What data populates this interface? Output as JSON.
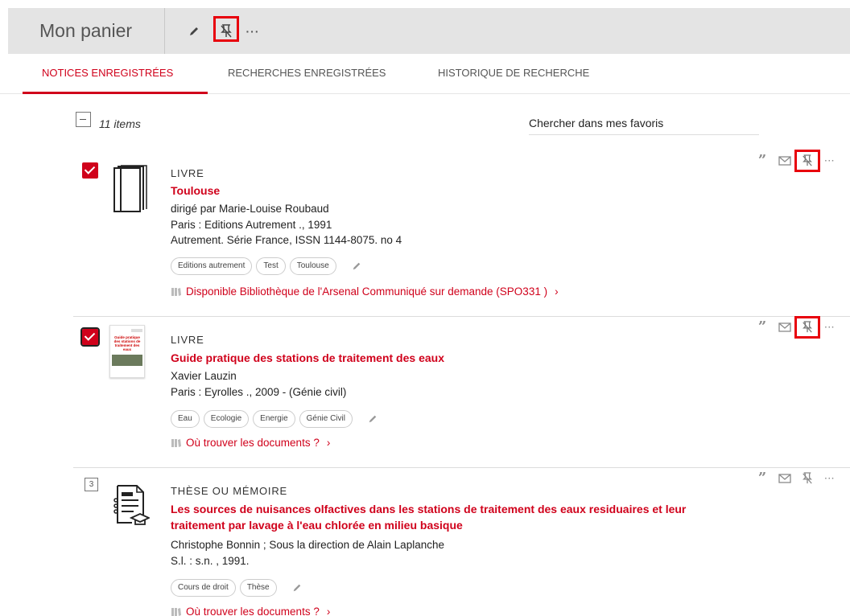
{
  "header": {
    "title": "Mon panier",
    "icons": [
      "pencil-icon",
      "unpin-icon",
      "more-icon"
    ],
    "more_label": "···"
  },
  "tabs": [
    {
      "label": "NOTICES ENREGISTRÉES",
      "active": true
    },
    {
      "label": "RECHERCHES ENREGISTRÉES",
      "active": false
    },
    {
      "label": "HISTORIQUE DE RECHERCHE",
      "active": false
    }
  ],
  "list": {
    "count": "11 items",
    "search_placeholder": "Chercher dans mes favoris"
  },
  "records": [
    {
      "checkbox": "checked",
      "type": "LIVRE",
      "title": "Toulouse",
      "lines": [
        "dirigé par Marie-Louise Roubaud",
        "Paris : Editions Autrement ., 1991",
        "Autrement. Série France, ISSN 1144-8075. no 4"
      ],
      "tags": [
        "Editions autrement",
        "Test",
        "Toulouse"
      ],
      "availability": "Disponible Bibliothèque de l'Arsenal  Communiqué sur demande (SPO331 )",
      "pin_highlighted": true
    },
    {
      "checkbox": "checked",
      "type": "LIVRE",
      "title": "Guide pratique des stations de traitement des eaux",
      "lines": [
        "Xavier Lauzin",
        "Paris : Eyrolles ., 2009 - (Génie civil)"
      ],
      "tags": [
        "Eau",
        "Ecologie",
        "Energie",
        "Génie Civil"
      ],
      "availability": "Où trouver les documents ?",
      "cover_text": "Guide pratique des stations de traitement des eaux",
      "pin_highlighted": true
    },
    {
      "checkbox": "3",
      "type": "THÈSE OU MÉMOIRE",
      "title": "Les sources de nuisances olfactives dans les stations de traitement des eaux residuaires et leur traitement par lavage à l'eau chlorée en milieu basique",
      "lines": [
        "Christophe Bonnin ; Sous la direction de Alain Laplanche",
        "S.l. : s.n. , 1991."
      ],
      "tags": [
        "Cours de droit",
        "Thèse"
      ],
      "availability": "Où trouver les documents ?",
      "pin_highlighted": false
    }
  ],
  "actions": {
    "quote": "”",
    "more": "···",
    "chevron": "›"
  },
  "colors": {
    "accent": "#d0011b",
    "highlight": "#e8000c",
    "topbar": "#e4e4e4"
  }
}
